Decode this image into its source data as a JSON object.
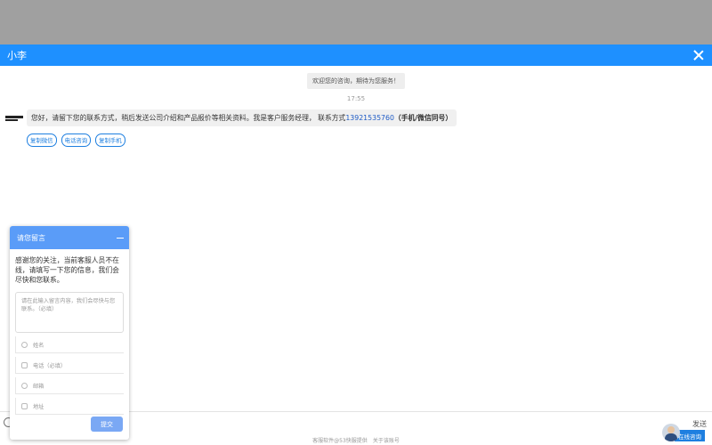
{
  "header": {
    "title": "小李"
  },
  "chat": {
    "welcome": "欢迎您的咨询，期待为您服务！",
    "timestamp": "17:55",
    "message": {
      "text_before": "您好，请留下您的联系方式，稍后发送公司介绍和产品报价等相关资料。我是客户服务经理，  联系方式",
      "phone": "13921535760",
      "bold_suffix": "（手机/微信同号）"
    },
    "quick_buttons": [
      "复制微信",
      "电话咨询",
      "复制手机"
    ]
  },
  "input": {
    "send_label": "发送"
  },
  "footer": {
    "left": "客服软件@53快服提供",
    "right": "关于该账号"
  },
  "online_widget": {
    "label": "在线咨询"
  },
  "message_panel": {
    "title": "请您留言",
    "intro": "感谢您的关注，当前客服人员不在线，请填写一下您的信息，我们会尽快和您联系。",
    "textarea_placeholder": "请在此输入留言内容，我们会尽快与您联系。（必填）",
    "fields": [
      {
        "placeholder": "姓名",
        "icon": "user-icon"
      },
      {
        "placeholder": "电话（必填）",
        "icon": "phone-icon"
      },
      {
        "placeholder": "邮箱",
        "icon": "email-icon"
      },
      {
        "placeholder": "地址",
        "icon": "address-icon"
      }
    ],
    "submit_label": "提交"
  },
  "colors": {
    "header": "#1e90ff",
    "panel_header": "#5a9cf8",
    "link": "#1e5bc6"
  }
}
